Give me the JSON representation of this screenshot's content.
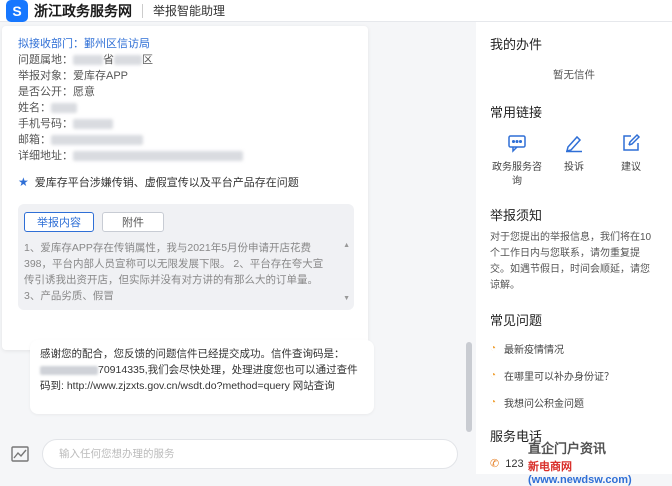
{
  "header": {
    "logo_glyph": "S",
    "site_name": "浙江政务服务网",
    "subtitle": "举报智能助理"
  },
  "card": {
    "dept": "拟接收部门：鄞州区信访局",
    "location_label": "问题属地：",
    "location_value_a": "省",
    "location_value_b": "区",
    "target": "举报对象：爱库存APP",
    "public": "是否公开：愿意",
    "name_label": "姓名：",
    "phone_label": "手机号码：",
    "email_label": "邮箱：",
    "address_label": "详细地址：",
    "summary": "爱库存平台涉嫌传销、虚假宣传以及平台产品存在问题",
    "tabs": [
      "举报内容",
      "附件"
    ],
    "detail": "1、爱库存APP存在传销属性，我与2021年5月份申请开店花费398，平台内部人员宣称可以无限发展下限。 2、平台存在夸大宣传引诱我出资开店，但实际并没有对方讲的有那么大的订单量。 3、产品劣质、假冒"
  },
  "reply": {
    "line1": "感谢您的配合，您反馈的问题信件已经提交成功。信件查询码是：",
    "code_tail": "70914335,我们会尽快处理，处理进度您也可以通过查件码到: http://www.zjzxts.gov.cn/wsdt.do?method=query 网站查询"
  },
  "input": {
    "placeholder": "输入任何您想办理的服务"
  },
  "sidebar": {
    "my_tasks_title": "我的办件",
    "my_tasks_empty": "暂无信件",
    "links_title": "常用链接",
    "links": [
      {
        "label": "政务服务咨询"
      },
      {
        "label": "投诉"
      },
      {
        "label": "建议"
      }
    ],
    "notice_title": "举报须知",
    "notice_text": "对于您提出的举报信息，我们将在10个工作日内与您联系，请勿重复提交。如遇节假日，时间会顺延，请您谅解。",
    "faq_title": "常见问题",
    "faq": [
      "最新疫情情况",
      "在哪里可以补办身份证？",
      "我想问公积金问题"
    ],
    "phone_title": "服务电话",
    "phone_value": "123"
  },
  "watermark": {
    "line1": "直企门户资讯",
    "line2_a": "新电商网",
    "line2_b": "(www.newdsw.com)"
  }
}
